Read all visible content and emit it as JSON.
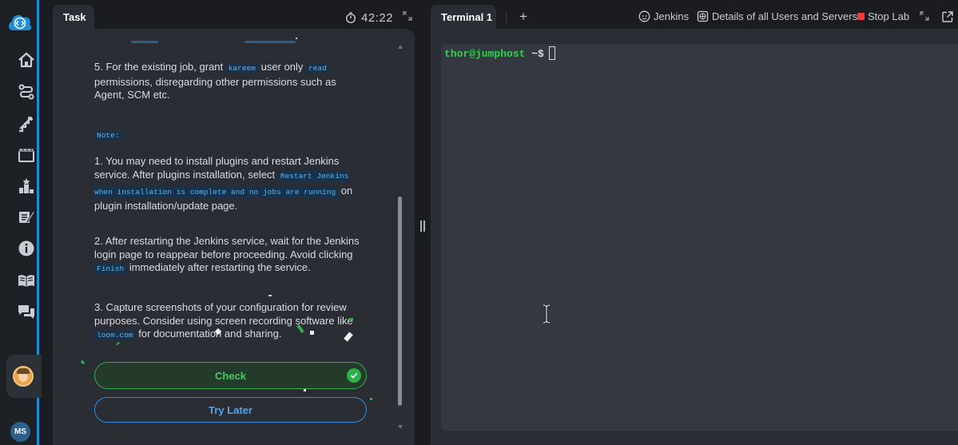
{
  "sidebar": {
    "logo": "cloud-code-icon",
    "items": [
      {
        "name": "home",
        "icon": "home-icon"
      },
      {
        "name": "learning-paths",
        "icon": "route-icon"
      },
      {
        "name": "progress",
        "icon": "stairs-icon"
      },
      {
        "name": "labs",
        "icon": "film-icon"
      },
      {
        "name": "leaderboard",
        "icon": "podium-icon"
      },
      {
        "name": "notes",
        "icon": "notebook-icon"
      },
      {
        "name": "info",
        "icon": "info-icon"
      },
      {
        "name": "docs",
        "icon": "book-icon"
      },
      {
        "name": "chat",
        "icon": "chat-icon"
      }
    ],
    "user_initials": "MS"
  },
  "task_panel": {
    "tab_label": "Task",
    "timer": "42:22",
    "step5": {
      "pre": "5. For the existing job, grant ",
      "code1": "kareem",
      "mid": " user only ",
      "code2": "read",
      "post": " permissions, disregarding other permissions such as Agent, SCM etc."
    },
    "note_label": "Note:",
    "note1": {
      "pre": "1. You may need to install plugins and restart Jenkins service. After plugins installation, select ",
      "code": "Restart Jenkins when installation is complete and no jobs are running",
      "post": " on plugin installation/update page."
    },
    "note2": {
      "pre": "2. After restarting the Jenkins service, wait for the Jenkins login page to reappear before proceeding. Avoid clicking ",
      "code": "Finish",
      "post": " immediately after restarting the service."
    },
    "note3": {
      "pre": "3. Capture screenshots of your configuration for review purposes. Consider using screen recording software like ",
      "code": "loom.com",
      "post": " for documentation and sharing."
    },
    "check_button": "Check",
    "try_later_button": "Try Later"
  },
  "terminal_panel": {
    "tab_label": "Terminal 1",
    "add_tab": "+",
    "toolbar": {
      "jenkins": "Jenkins",
      "details": "Details of all Users and Servers",
      "stop_lab": "Stop Lab"
    },
    "prompt_user": "thor@jumphost",
    "prompt_symbol": "~$"
  },
  "colors": {
    "accent_blue": "#1e8fd6",
    "check_green": "#2fb04a",
    "prompt_green": "#2ad44a",
    "stop_red": "#ef3b3b"
  }
}
